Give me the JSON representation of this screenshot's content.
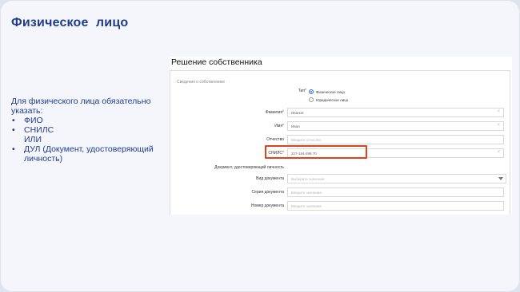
{
  "slide": {
    "title": "Физическое  лицо",
    "intro": "Для физического лица обязательно указать:",
    "bullets": [
      {
        "text": "ФИО",
        "bullet": true
      },
      {
        "text": "СНИЛС",
        "bullet": true
      },
      {
        "text": "ИЛИ",
        "bullet": false
      },
      {
        "text": "ДУЛ (Документ, удостоверяющий личность)",
        "bullet": true
      }
    ]
  },
  "form": {
    "title": "Решение собственника",
    "section": "Сведения о собственнике",
    "type_label": "Тип",
    "type_options": [
      {
        "label": "Физическое лицо",
        "selected": true
      },
      {
        "label": "Юридическое лицо",
        "selected": false
      }
    ],
    "fields": {
      "surname": {
        "label": "Фамилия",
        "value": "Иванов",
        "required": true
      },
      "name": {
        "label": "Имя",
        "value": "Иван",
        "required": true
      },
      "patronymic": {
        "label": "Отчество",
        "placeholder": "Введите отчество"
      },
      "snils": {
        "label": "СНИЛС",
        "value": "227-184-288 70",
        "required": true
      }
    },
    "doc_section": "Документ, удостоверяющий личность",
    "doc_fields": {
      "type": {
        "label": "Вид документа",
        "placeholder": "Выберите значение"
      },
      "series": {
        "label": "Серия документа",
        "placeholder": "Введите значение"
      },
      "number": {
        "label": "Номер документа",
        "placeholder": "Введите значение"
      }
    },
    "required_mark": "*",
    "clear_glyph": "×"
  },
  "colors": {
    "title": "#1f3b8f",
    "highlight": "#e0421b",
    "radio_active": "#1e6fe0"
  }
}
